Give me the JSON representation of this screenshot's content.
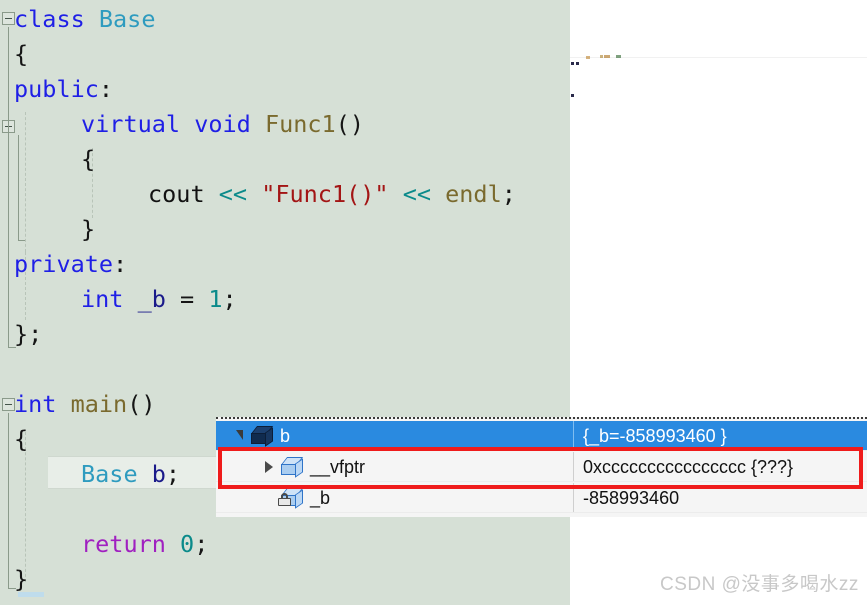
{
  "editor": {
    "background_color": "#d6e0d6",
    "current_line_highlight_color": "#e8eee8",
    "lines": [
      {
        "indent": 0,
        "tokens": [
          {
            "text": "class ",
            "cls": "t-kw"
          },
          {
            "text": "Base",
            "cls": "t-type"
          }
        ]
      },
      {
        "indent": 0,
        "tokens": [
          {
            "text": "{",
            "cls": "t-punct"
          }
        ]
      },
      {
        "indent": 0,
        "tokens": [
          {
            "text": "public",
            "cls": "t-kw"
          },
          {
            "text": ":",
            "cls": "t-punct"
          }
        ]
      },
      {
        "indent": 1,
        "tokens": [
          {
            "text": "virtual ",
            "cls": "t-kw"
          },
          {
            "text": "void ",
            "cls": "t-kw"
          },
          {
            "text": "Func1",
            "cls": "t-fn"
          },
          {
            "text": "()",
            "cls": "t-punct"
          }
        ]
      },
      {
        "indent": 1,
        "tokens": [
          {
            "text": "{",
            "cls": "t-punct"
          }
        ]
      },
      {
        "indent": 2,
        "tokens": [
          {
            "text": "cout ",
            "cls": "t-plain"
          },
          {
            "text": "<< ",
            "cls": "t-op"
          },
          {
            "text": "\"Func1()\"",
            "cls": "t-str"
          },
          {
            "text": " << ",
            "cls": "t-op"
          },
          {
            "text": "endl",
            "cls": "t-fn"
          },
          {
            "text": ";",
            "cls": "t-punct"
          }
        ]
      },
      {
        "indent": 1,
        "tokens": [
          {
            "text": "}",
            "cls": "t-punct"
          }
        ]
      },
      {
        "indent": 0,
        "tokens": [
          {
            "text": "private",
            "cls": "t-kw"
          },
          {
            "text": ":",
            "cls": "t-punct"
          }
        ]
      },
      {
        "indent": 1,
        "tokens": [
          {
            "text": "int ",
            "cls": "t-kw"
          },
          {
            "text": "_b ",
            "cls": "t-ident"
          },
          {
            "text": "= ",
            "cls": "t-punct"
          },
          {
            "text": "1",
            "cls": "t-num"
          },
          {
            "text": ";",
            "cls": "t-punct"
          }
        ]
      },
      {
        "indent": 0,
        "tokens": [
          {
            "text": "};",
            "cls": "t-punct"
          }
        ]
      },
      {
        "indent": 0,
        "tokens": [
          {
            "text": "",
            "cls": "t-plain"
          }
        ]
      },
      {
        "indent": 0,
        "tokens": [
          {
            "text": "int ",
            "cls": "t-kw"
          },
          {
            "text": "main",
            "cls": "t-fn"
          },
          {
            "text": "()",
            "cls": "t-punct"
          }
        ]
      },
      {
        "indent": 0,
        "tokens": [
          {
            "text": "{",
            "cls": "t-punct"
          }
        ]
      },
      {
        "indent": 1,
        "tokens": [
          {
            "text": "Base ",
            "cls": "t-type"
          },
          {
            "text": "b",
            "cls": "t-ident"
          },
          {
            "text": ";",
            "cls": "t-punct"
          }
        ]
      },
      {
        "indent": 0,
        "tokens": [
          {
            "text": "",
            "cls": "t-plain"
          }
        ]
      },
      {
        "indent": 1,
        "tokens": [
          {
            "text": "return ",
            "cls": "t-ctl"
          },
          {
            "text": "0",
            "cls": "t-num"
          },
          {
            "text": ";",
            "cls": "t-punct"
          }
        ]
      },
      {
        "indent": 0,
        "tokens": [
          {
            "text": "}",
            "cls": "t-punct"
          }
        ]
      }
    ],
    "current_line_index": 13
  },
  "datatip": {
    "rows": [
      {
        "name": "b",
        "value": "{_b=-858993460 }",
        "expander": "down",
        "selected": true,
        "icon": "object-box-icon",
        "locked": false,
        "depth": 0
      },
      {
        "name": "__vfptr",
        "value": "0xcccccccccccccccc {???}",
        "expander": "right",
        "selected": false,
        "icon": "object-box-icon",
        "locked": false,
        "depth": 1
      },
      {
        "name": "_b",
        "value": "-858993460",
        "expander": "none",
        "selected": false,
        "icon": "private-field-box-icon",
        "locked": true,
        "depth": 1
      }
    ],
    "selected_row_color": "#2a8ae0",
    "background_color": "#f5f5f5"
  },
  "annotation": {
    "highlight_color": "#ef1b1b",
    "target_row": "__vfptr"
  },
  "watermark": {
    "text": "CSDN @没事多喝水zz",
    "color": "#c8c8c8"
  }
}
